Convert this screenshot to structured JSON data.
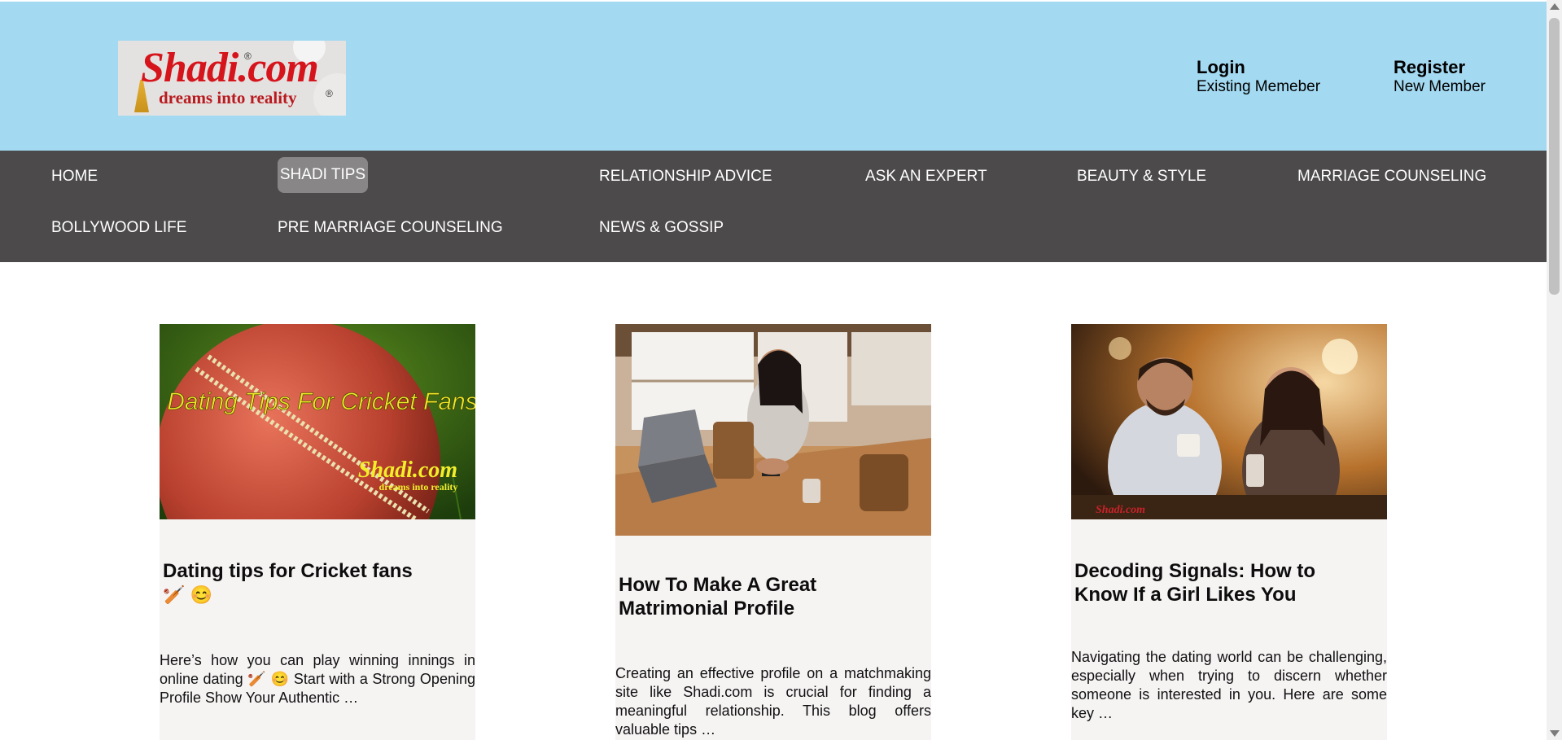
{
  "header": {
    "logo": {
      "brand": "Shadi.com",
      "tagline": "dreams into reality",
      "reg": "®"
    },
    "login": {
      "title": "Login",
      "subtitle": "Existing Memeber"
    },
    "register": {
      "title": "Register",
      "subtitle": "New Member"
    }
  },
  "nav": {
    "items": [
      {
        "label": "HOME"
      },
      {
        "label": "SHADI TIPS"
      },
      {
        "label": "RELATIONSHIP ADVICE"
      },
      {
        "label": "ASK AN EXPERT"
      },
      {
        "label": "BEAUTY & STYLE"
      },
      {
        "label": "MARRIAGE COUNSELING"
      },
      {
        "label": "BOLLYWOOD LIFE"
      },
      {
        "label": "PRE MARRIAGE COUNSELING"
      },
      {
        "label": "NEWS & GOSSIP"
      }
    ],
    "active": "SHADI TIPS"
  },
  "posts": [
    {
      "title": "Dating tips for Cricket fans",
      "title_emoji": "🏏 😊",
      "image_text": "Dating Tips For Cricket Fans",
      "image_brand": "Shadi.com",
      "image_tagline": "dreams into reality",
      "excerpt": "Here’s how you can play winning innings in online dating 🏏 😊 Start with a Strong Opening Profile Show Your Authentic …"
    },
    {
      "title": "How To Make A Great Matrimonial Profile",
      "excerpt": "Creating an effective profile on a matchmaking site like Shadi.com is crucial for finding a meaningful relationship. This blog offers valuable tips …"
    },
    {
      "title": "Decoding Signals: How to Know If a Girl Likes You",
      "image_brand": "Shadi.com",
      "excerpt": "Navigating the dating world can be challenging, especially when trying to discern whether someone is interested in you. Here are some key …"
    }
  ],
  "colors": {
    "header_bg": "#a3d9f1",
    "nav_bg": "#4c4a4b",
    "nav_active": "#888687",
    "card_bg": "#f6f3f3",
    "brand_red": "#d6141c"
  }
}
